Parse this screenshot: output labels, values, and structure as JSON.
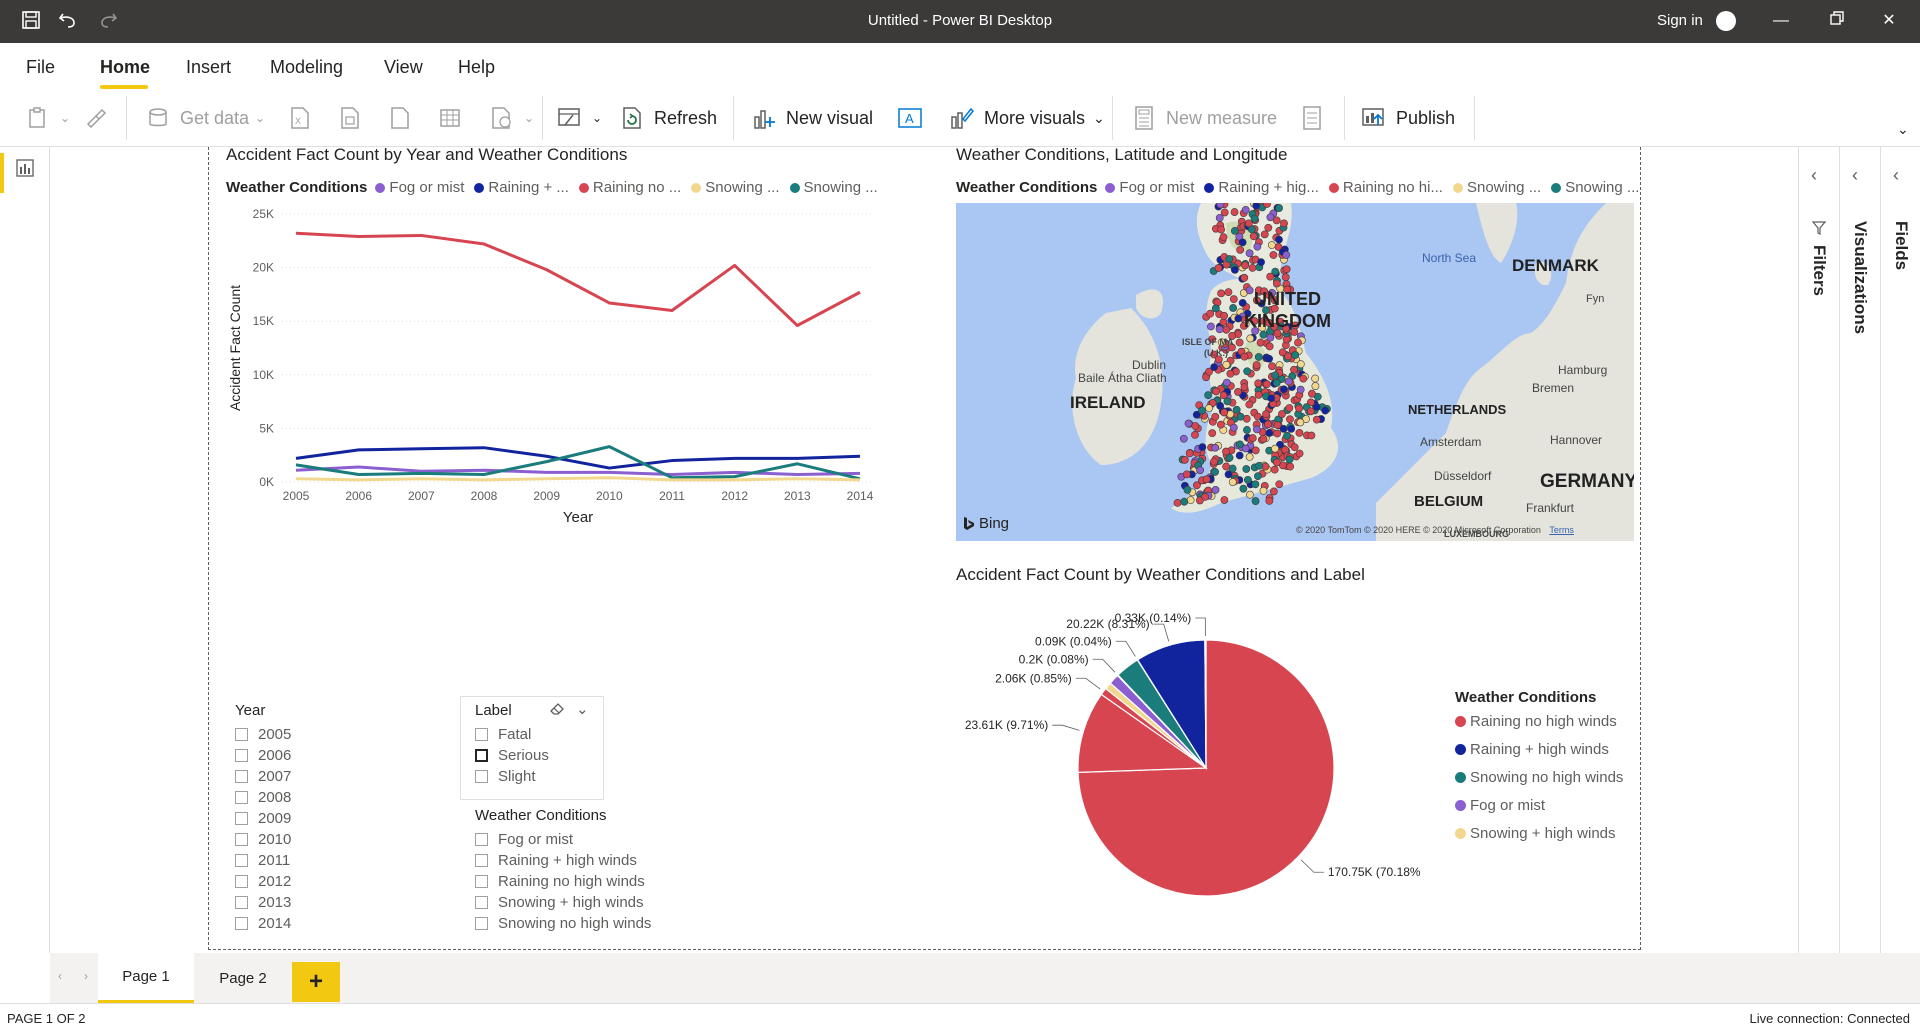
{
  "window": {
    "title": "Untitled - Power BI Desktop",
    "sign_in": "Sign in"
  },
  "menu": {
    "items": [
      "File",
      "Home",
      "Insert",
      "Modeling",
      "View",
      "Help"
    ],
    "active": "Home"
  },
  "toolbar": {
    "get_data": "Get data",
    "refresh": "Refresh",
    "new_visual": "New visual",
    "more_visuals": "More visuals",
    "new_measure": "New measure",
    "publish": "Publish"
  },
  "line_chart": {
    "title": "Accident Fact Count by Year and Weather Conditions",
    "legend_title": "Weather Conditions",
    "legend_items": [
      "Fog or mist",
      "Raining + ...",
      "Raining no ...",
      "Snowing ...",
      "Snowing ..."
    ],
    "xlabel": "Year",
    "ylabel": "Accident Fact Count",
    "ytick_labels": [
      "25K",
      "20K",
      "15K",
      "10K",
      "5K",
      "0K"
    ]
  },
  "map": {
    "title": "Weather Conditions, Latitude and Longitude",
    "legend_title": "Weather Conditions",
    "legend_items": [
      "Fog or mist",
      "Raining + hig...",
      "Raining no hi...",
      "Snowing ...",
      "Snowing ..."
    ],
    "labels": {
      "uk1": "UNITED",
      "uk2": "KINGDOM",
      "ireland": "IRELAND",
      "denmark": "DENMARK",
      "netherlands": "NETHERLANDS",
      "germany": "GERMANY",
      "belgium": "BELGIUM",
      "north_sea": "North Sea",
      "dublin": "Dublin",
      "baile": "Baile Átha Cliath",
      "isle": "ISLE OF MA",
      "isle2": "(U.K.)",
      "amsterdam": "Amsterdam",
      "hamburg": "Hamburg",
      "bremen": "Bremen",
      "hannover": "Hannover",
      "dusseldorf": "Düsseldorf",
      "frankfurt": "Frankfurt",
      "luxembourg": "LUXEMBOURG",
      "fyn": "Fyn",
      "bing": "Bing",
      "copyright": "© 2020 TomTom © 2020 HERE © 2020 Microsoft Corporation",
      "terms": "Terms"
    }
  },
  "pie": {
    "title": "Accident Fact Count by Weather Conditions and Label",
    "legend_title": "Weather Conditions",
    "legend_items": [
      "Raining no high winds",
      "Raining + high winds",
      "Snowing no high winds",
      "Fog or mist",
      "Snowing + high winds"
    ],
    "data_labels": [
      "170.75K (70.18%)",
      "23.61K (9.71%)",
      "2.06K (0.85%)",
      "0.2K (0.08%)",
      "0.09K (0.04%)",
      "20.22K (8.31%)",
      "0.33K (0.14%)"
    ]
  },
  "slicer_year": {
    "title": "Year",
    "items": [
      "2005",
      "2006",
      "2007",
      "2008",
      "2009",
      "2010",
      "2011",
      "2012",
      "2013",
      "2014"
    ]
  },
  "slicer_label": {
    "title": "Label",
    "items": [
      "Fatal",
      "Serious",
      "Slight"
    ]
  },
  "slicer_weather": {
    "title": "Weather Conditions",
    "items": [
      "Fog or mist",
      "Raining + high winds",
      "Raining no high winds",
      "Snowing + high winds",
      "Snowing no high winds"
    ]
  },
  "panes": {
    "filters": "Filters",
    "visualizations": "Visualizations",
    "fields": "Fields"
  },
  "pages": {
    "tabs": [
      "Page 1",
      "Page 2"
    ],
    "active": "Page 1",
    "add": "+"
  },
  "status": {
    "page": "PAGE 1 OF 2",
    "connection": "Live connection: Connected"
  },
  "colors": {
    "fog": "#8c5fd1",
    "rain_wind": "#12239e",
    "rain_no": "#d64550",
    "snow_wind": "#f2d88e",
    "snow_no": "#1b7c7c",
    "accent": "#f2c811"
  },
  "chart_data": [
    {
      "type": "line",
      "title": "Accident Fact Count by Year and Weather Conditions",
      "x": [
        2005,
        2006,
        2007,
        2008,
        2009,
        2010,
        2011,
        2012,
        2013,
        2014
      ],
      "xlabel": "Year",
      "ylabel": "Accident Fact Count",
      "ylim": [
        0,
        25000
      ],
      "yticks": [
        0,
        5000,
        10000,
        15000,
        20000,
        25000
      ],
      "grid": true,
      "legend": "top",
      "series": [
        {
          "name": "Raining no high winds",
          "color": "#d64550",
          "values": [
            23200,
            22900,
            23000,
            22200,
            19800,
            16700,
            16000,
            20200,
            14600,
            17700
          ]
        },
        {
          "name": "Raining + high winds",
          "color": "#12239e",
          "values": [
            2200,
            3000,
            3100,
            3200,
            2400,
            1300,
            2000,
            2200,
            2200,
            2400
          ]
        },
        {
          "name": "Fog or mist",
          "color": "#8c5fd1",
          "values": [
            1100,
            1400,
            1000,
            1100,
            900,
            900,
            700,
            900,
            700,
            800
          ]
        },
        {
          "name": "Snowing no high winds",
          "color": "#1b7c7c",
          "values": [
            1600,
            700,
            800,
            700,
            1900,
            3300,
            400,
            500,
            1700,
            300
          ]
        },
        {
          "name": "Snowing + high winds",
          "color": "#f2d88e",
          "values": [
            300,
            200,
            300,
            200,
            300,
            400,
            200,
            200,
            300,
            200
          ]
        }
      ]
    },
    {
      "type": "pie",
      "title": "Accident Fact Count by Weather Conditions and Label",
      "legend": "right",
      "slices": [
        {
          "name": "Raining no high winds",
          "value": 170750,
          "label": "170.75K (70.18%)",
          "color": "#d64550"
        },
        {
          "name": "Raining no high winds",
          "value": 23610,
          "label": "23.61K (9.71%)",
          "color": "#d64550"
        },
        {
          "name": "Raining no high winds",
          "value": 2060,
          "label": "2.06K (0.85%)",
          "color": "#d64550"
        },
        {
          "name": "Snowing + high winds",
          "value": 2060,
          "label": "",
          "color": "#f2d88e"
        },
        {
          "name": "Fog or mist",
          "value": 3000,
          "label": "",
          "color": "#8c5fd1"
        },
        {
          "name": "Fog or mist",
          "value": 200,
          "label": "0.2K (0.08%)",
          "color": "#8c5fd1"
        },
        {
          "name": "Snowing no high winds",
          "value": 7000,
          "label": "",
          "color": "#1b7c7c"
        },
        {
          "name": "Raining + high winds",
          "value": 90,
          "label": "0.09K (0.04%)",
          "color": "#12239e"
        },
        {
          "name": "Raining + high winds",
          "value": 20220,
          "label": "20.22K (8.31%)",
          "color": "#12239e"
        },
        {
          "name": "Raining + high winds",
          "value": 330,
          "label": "0.33K (0.14%)",
          "color": "#12239e"
        }
      ]
    }
  ]
}
